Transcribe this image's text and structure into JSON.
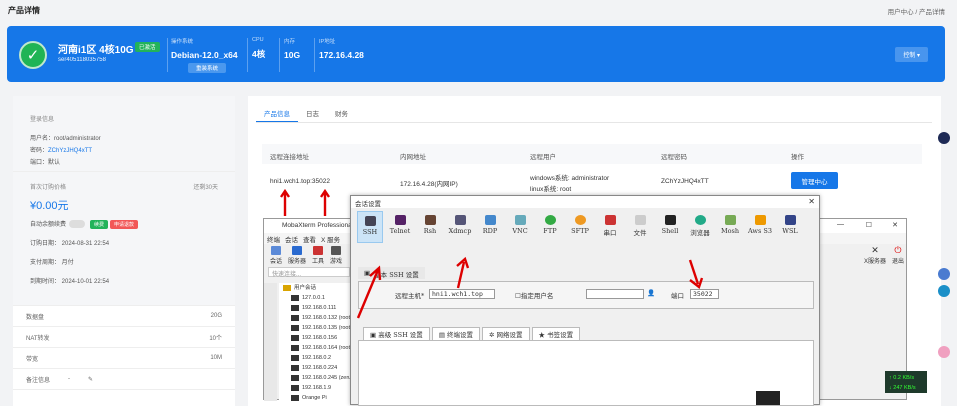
{
  "page": {
    "title": "产品详情",
    "breadcrumb": "用户中心 / 产品详情"
  },
  "hero": {
    "name": "河南i1区 4核10G",
    "status": "已激活",
    "server_id": "ser405118035758",
    "os_label": "操作系统",
    "os": "Debian-12.0_x64",
    "reinstall": "重装系统",
    "cpu_label": "CPU",
    "cpu": "4核",
    "mem_label": "内存",
    "mem": "10G",
    "ip_label": "IP地址",
    "ip": "172.16.4.28",
    "control": "控制 ▾"
  },
  "left": {
    "login_title": "登录信息",
    "username": "用户名：root/administrator",
    "password_label": "密码：",
    "password": "ZChYzJHQ4xTT",
    "port": "端口：默认",
    "price_label": "首次订购价格",
    "expires": "还剩30天",
    "price": "¥0.00元",
    "auto_renew": "自动余额续费",
    "renew_btn": "续费",
    "apply_btn": "申请退款",
    "order_time": "订购日期：  2024-08-31 22:54",
    "pay_cycle": "支付周期：  月付",
    "expire_time": "到期时间：  2024-10-01 22:54",
    "disk_label": "数据盘",
    "disk": "20G",
    "nat_label": "NAT转发",
    "nat": "10个",
    "bw_label": "带宽",
    "bw": "10M",
    "note_label": "备注信息",
    "note": "-"
  },
  "right": {
    "tabs": [
      "产品信息",
      "日志",
      "财务"
    ],
    "headers": [
      "远程连接地址",
      "内网地址",
      "远程用户",
      "远程密码",
      "操作"
    ],
    "addr": "hni1.wch1.top:35022",
    "inner": "172.16.4.28(内网IP)",
    "user1": "windows系统: administrator",
    "user2": "linux系统: root",
    "pass": "ZChYzJHQ4xTT",
    "manage": "管理中心"
  },
  "mobax": {
    "title": "MobaXterm Professional",
    "menu": [
      "终端",
      "会话",
      "查看",
      "X 服务"
    ],
    "tools": [
      "会话",
      "服务器",
      "工具",
      "游戏"
    ],
    "quick": "快速连接...",
    "tree_root": "用户会话",
    "sessions": [
      "127.0.0.1",
      "192.168.0.111",
      "192.168.0.132 (root)",
      "192.168.0.135 (root)",
      "192.168.0.156",
      "192.168.0.164 (root)",
      "192.168.0.2",
      "192.168.0.224",
      "192.168.0.245 (zeru)",
      "192.168.1.9",
      "Orange Pi"
    ],
    "xserver": "X服务器",
    "exit": "退出"
  },
  "dialog": {
    "title": "会话设置",
    "types": [
      "SSH",
      "Telnet",
      "Rsh",
      "Xdmcp",
      "RDP",
      "VNC",
      "FTP",
      "SFTP",
      "串口",
      "文件",
      "Shell",
      "浏览器",
      "Mosh",
      "Aws S3",
      "WSL"
    ],
    "basic": "基本 SSH 设置",
    "host_label": "远程主机*",
    "host": "hni1.wch1.top",
    "user_chk": "指定用户名",
    "port_label": "端口",
    "port": "35022",
    "tabs": [
      "高级 SSH 设置",
      "终端设置",
      "网络设置",
      "书签设置"
    ]
  },
  "net": {
    "up": "↑ 0.2 KB/s",
    "down": "↓ 247 KB/s"
  }
}
